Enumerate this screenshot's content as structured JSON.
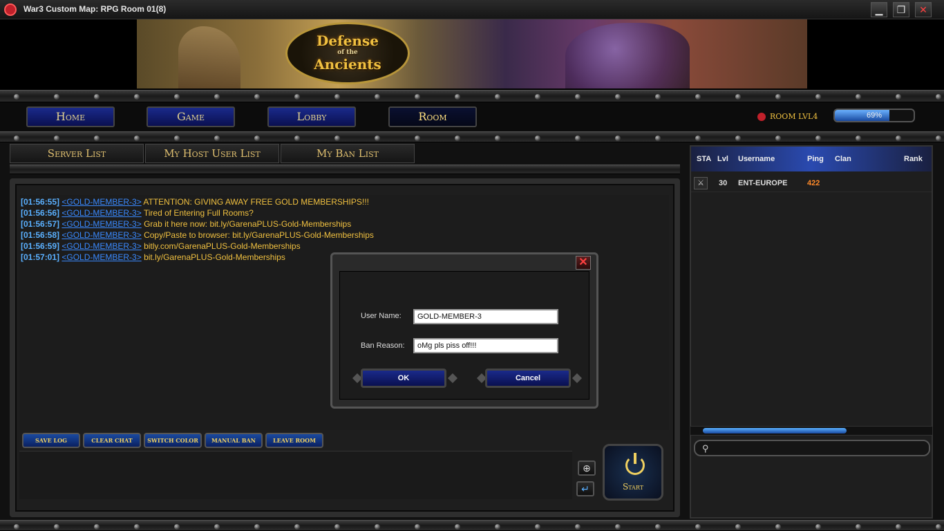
{
  "window": {
    "title": "War3 Custom Map: RPG Room 01(8)",
    "minimize_icon": "minimize-icon",
    "restore_icon": "restore-icon",
    "close_icon": "close-icon"
  },
  "banner": {
    "line1": "Defense",
    "line2": "of the",
    "line3": "Ancients"
  },
  "nav": {
    "items": [
      "Home",
      "Game",
      "Lobby",
      "Room"
    ],
    "active": "Room"
  },
  "room_level": {
    "label": "ROOM LVL4"
  },
  "progress": {
    "value": 69,
    "label": "69%"
  },
  "tabs": [
    "Server List",
    "My Host User List",
    "My Ban List"
  ],
  "chat": {
    "lines": [
      {
        "time": "[01:56:55]",
        "user": "<GOLD-MEMBER-3>",
        "text": "ATTENTION: GIVING AWAY FREE GOLD MEMBERSHIPS!!!"
      },
      {
        "time": "[01:56:56]",
        "user": "<GOLD-MEMBER-3>",
        "text": "Tired of Entering Full Rooms?"
      },
      {
        "time": "[01:56:57]",
        "user": "<GOLD-MEMBER-3>",
        "text": "Grab it here now: bit.ly/GarenaPLUS-Gold-Memberships"
      },
      {
        "time": "[01:56:58]",
        "user": "<GOLD-MEMBER-3>",
        "text": "Copy/Paste to browser: bit.ly/GarenaPLUS-Gold-Memberships"
      },
      {
        "time": "[01:56:59]",
        "user": "<GOLD-MEMBER-3>",
        "text": "bitly.com/GarenaPLUS-Gold-Memberships"
      },
      {
        "time": "[01:57:01]",
        "user": "<GOLD-MEMBER-3>",
        "text": "bit.ly/GarenaPLUS-Gold-Memberships"
      }
    ],
    "buttons": [
      "SAVE LOG",
      "CLEAR CHAT",
      "SWITCH COLOR",
      "MANUAL BAN",
      "LEAVE ROOM"
    ],
    "start_label": "Start"
  },
  "userlist": {
    "headers": {
      "sta": "STA",
      "lvl": "Lvl",
      "username": "Username",
      "ping": "Ping",
      "clan": "Clan",
      "rank": "Rank"
    },
    "rows": [
      {
        "lvl": "30",
        "username": "ENT-EUROPE",
        "ping": "422",
        "clan": "",
        "rank": ""
      }
    ],
    "ping_color": "#ff8a2a"
  },
  "dialog": {
    "user_name_label": "User Name:",
    "user_name_value": "GOLD-MEMBER-3",
    "ban_reason_label": "Ban Reason:",
    "ban_reason_value": "oMg pls piss off!!!",
    "ok_label": "OK",
    "cancel_label": "Cancel",
    "close_glyph": "✕"
  },
  "colors": {
    "accent_gold": "#f0c040",
    "timestamp_blue": "#5ab0ff",
    "username_blue": "#3a8aff",
    "button_blue": "#1a2a8a"
  }
}
